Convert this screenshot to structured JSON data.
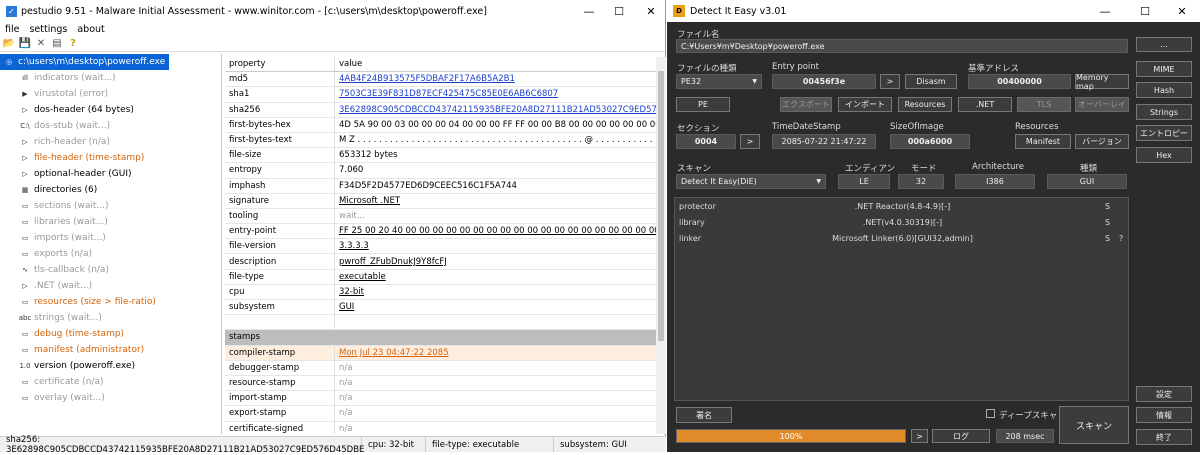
{
  "pe": {
    "title": "pestudio 9.51 - Malware Initial Assessment - www.winitor.com - [c:\\users\\m\\desktop\\poweroff.exe]",
    "menu": [
      "file",
      "settings",
      "about"
    ],
    "tree": [
      {
        "label": "c:\\users\\m\\desktop\\poweroff.exe",
        "style": "root",
        "icon": "◎"
      },
      {
        "label": "indicators (wait...)",
        "style": "gray",
        "icon": "ıll"
      },
      {
        "label": "virustotal (error)",
        "style": "gray",
        "icon": "▶"
      },
      {
        "label": "dos-header (64 bytes)",
        "style": "black",
        "icon": "▷"
      },
      {
        "label": "dos-stub (wait...)",
        "style": "gray",
        "icon": "C:\\"
      },
      {
        "label": "rich-header (n/a)",
        "style": "gray",
        "icon": "▷"
      },
      {
        "label": "file-header (time-stamp)",
        "style": "orange",
        "icon": "▷"
      },
      {
        "label": "optional-header (GUI)",
        "style": "black",
        "icon": "▷"
      },
      {
        "label": "directories (6)",
        "style": "black",
        "icon": "▦"
      },
      {
        "label": "sections (wait...)",
        "style": "gray",
        "icon": "▭"
      },
      {
        "label": "libraries (wait...)",
        "style": "gray",
        "icon": "▭"
      },
      {
        "label": "imports (wait...)",
        "style": "gray",
        "icon": "▭"
      },
      {
        "label": "exports (n/a)",
        "style": "gray",
        "icon": "▭"
      },
      {
        "label": "tls-callback (n/a)",
        "style": "gray",
        "icon": "∿"
      },
      {
        "label": ".NET (wait...)",
        "style": "gray",
        "icon": "▷"
      },
      {
        "label": "resources (size > file-ratio)",
        "style": "orange",
        "icon": "▭"
      },
      {
        "label": "strings (wait...)",
        "style": "gray",
        "icon": "abc"
      },
      {
        "label": "debug (time-stamp)",
        "style": "orange",
        "icon": "▭"
      },
      {
        "label": "manifest (administrator)",
        "style": "orange",
        "icon": "▭"
      },
      {
        "label": "version (poweroff.exe)",
        "style": "black",
        "icon": "1.0"
      },
      {
        "label": "certificate (n/a)",
        "style": "gray",
        "icon": "▭"
      },
      {
        "label": "overlay (wait...)",
        "style": "gray",
        "icon": "▭"
      }
    ],
    "header": [
      "property",
      "value"
    ],
    "rows": [
      [
        "md5",
        "4AB4F24B913575F5DBAF2F17A6B5A2B1",
        "link"
      ],
      [
        "sha1",
        "7503C3E39F831D87ECF425475C85E0E6AB6C6807",
        "link"
      ],
      [
        "sha256",
        "3E62898C905CDBCCD43742115935BFE20A8D27111B21AD53027C9ED576D45DBE",
        "link"
      ],
      [
        "first-bytes-hex",
        "4D 5A 90 00 03 00 00 00 04 00 00 00 FF FF 00 00 B8 00 00 00 00 00 00 00 40 00 00 00 00 00 00",
        "plain"
      ],
      [
        "first-bytes-text",
        "M Z . . . . . . . . . . . . . . . . . . . . . . . . . . . . . . . . . . . . . . . . . . @ . . . . . . . . . . . . . . . .",
        "plain"
      ],
      [
        "file-size",
        "653312 bytes",
        "plain"
      ],
      [
        "entropy",
        "7.060",
        "plain"
      ],
      [
        "imphash",
        "F34D5F2D4577ED6D9CEEC516C1F5A744",
        "plain"
      ],
      [
        "signature",
        "Microsoft .NET",
        "ud"
      ],
      [
        "tooling",
        "wait...",
        "gray"
      ],
      [
        "entry-point",
        "FF 25 00 20 40 00 00 00 00 00 00 00 00 00 00 00 00 00 00 00 00 00 00 00 00 00 00 00 00 00 00 00",
        "ud"
      ],
      [
        "file-version",
        "3.3.3.3",
        "ud"
      ],
      [
        "description",
        "pwroff_ZFubDnukJ9Y8fcFJ",
        "ud"
      ],
      [
        "file-type",
        "executable",
        "ud"
      ],
      [
        "cpu",
        "32-bit",
        "ud"
      ],
      [
        "subsystem",
        "GUI",
        "ud"
      ],
      [
        "",
        "",
        "plain"
      ],
      [
        "stamps",
        "",
        "section"
      ],
      [
        "compiler-stamp",
        "Mon Jul 23 04:47:22 2085",
        "orange"
      ],
      [
        "debugger-stamp",
        "n/a",
        "gray"
      ],
      [
        "resource-stamp",
        "n/a",
        "gray"
      ],
      [
        "import-stamp",
        "n/a",
        "gray"
      ],
      [
        "export-stamp",
        "n/a",
        "gray"
      ],
      [
        "certificate-signed",
        "n/a",
        "gray"
      ],
      [
        "certificate-valid-from",
        "n/a",
        "gray"
      ],
      [
        "certificate-valid-to",
        "n/a",
        "gray"
      ]
    ],
    "status": [
      "sha256: 3E62898C905CDBCCD43742115935BFE20A8D27111B21AD53027C9ED576D45DBE",
      "cpu: 32-bit",
      "file-type: executable",
      "subsystem: GUI"
    ]
  },
  "die": {
    "title": "Detect It Easy v3.01",
    "filename_label": "ファイル名",
    "filename": "C:¥Users¥m¥Desktop¥poweroff.exe",
    "browse": "...",
    "filetype_label": "ファイルの種類",
    "filetype": "PE32",
    "entry_label": "Entry point",
    "entry": "00456f3e",
    "base_label": "基準アドレス",
    "base": "00400000",
    "disasm": "Disasm",
    "memmap": "Memory map",
    "arrow": ">",
    "btn_pe": "PE",
    "btn_export": "エクスポート",
    "btn_import": "インポート",
    "btn_res": "Resources",
    "btn_net": ".NET",
    "btn_tls": "TLS",
    "btn_overlay": "オーバーレイ",
    "section_label": "セクション",
    "section": "0004",
    "tds_label": "TimeDateStamp",
    "tds": "2085-07-22 21:47:22",
    "soi_label": "SizeOfImage",
    "soi": "000a6000",
    "res_label": "Resources",
    "manifest": "Manifest",
    "version": "バージョン",
    "scan_label": "スキャン",
    "scan": "Detect It Easy(DiE)",
    "endian_label": "エンディアン",
    "endian": "LE",
    "mode_label": "モード",
    "mode": "32",
    "arch_label": "Architecture",
    "arch": "I386",
    "type_label": "種類",
    "type": "GUI",
    "results": [
      [
        "protector",
        ".NET Reactor(4.8-4.9)[-]",
        "S",
        ""
      ],
      [
        "library",
        ".NET(v4.0.30319)[-]",
        "S",
        ""
      ],
      [
        "linker",
        "Microsoft Linker(6.0)[GUI32,admin]",
        "S",
        "?"
      ]
    ],
    "side": [
      "MIME",
      "Hash",
      "Strings",
      "エントロピー",
      "Hex"
    ],
    "settings": "設定",
    "info": "情報",
    "exit": "終了",
    "signature": "署名",
    "deep": "ディープスキャン",
    "scanbtn": "スキャン",
    "progress": "100%",
    "log": "ログ",
    "time": "208 msec",
    "colors": {
      "progress": "#e08a2c",
      "orange": "#d4640a",
      "link": "#1a3fcc"
    }
  }
}
